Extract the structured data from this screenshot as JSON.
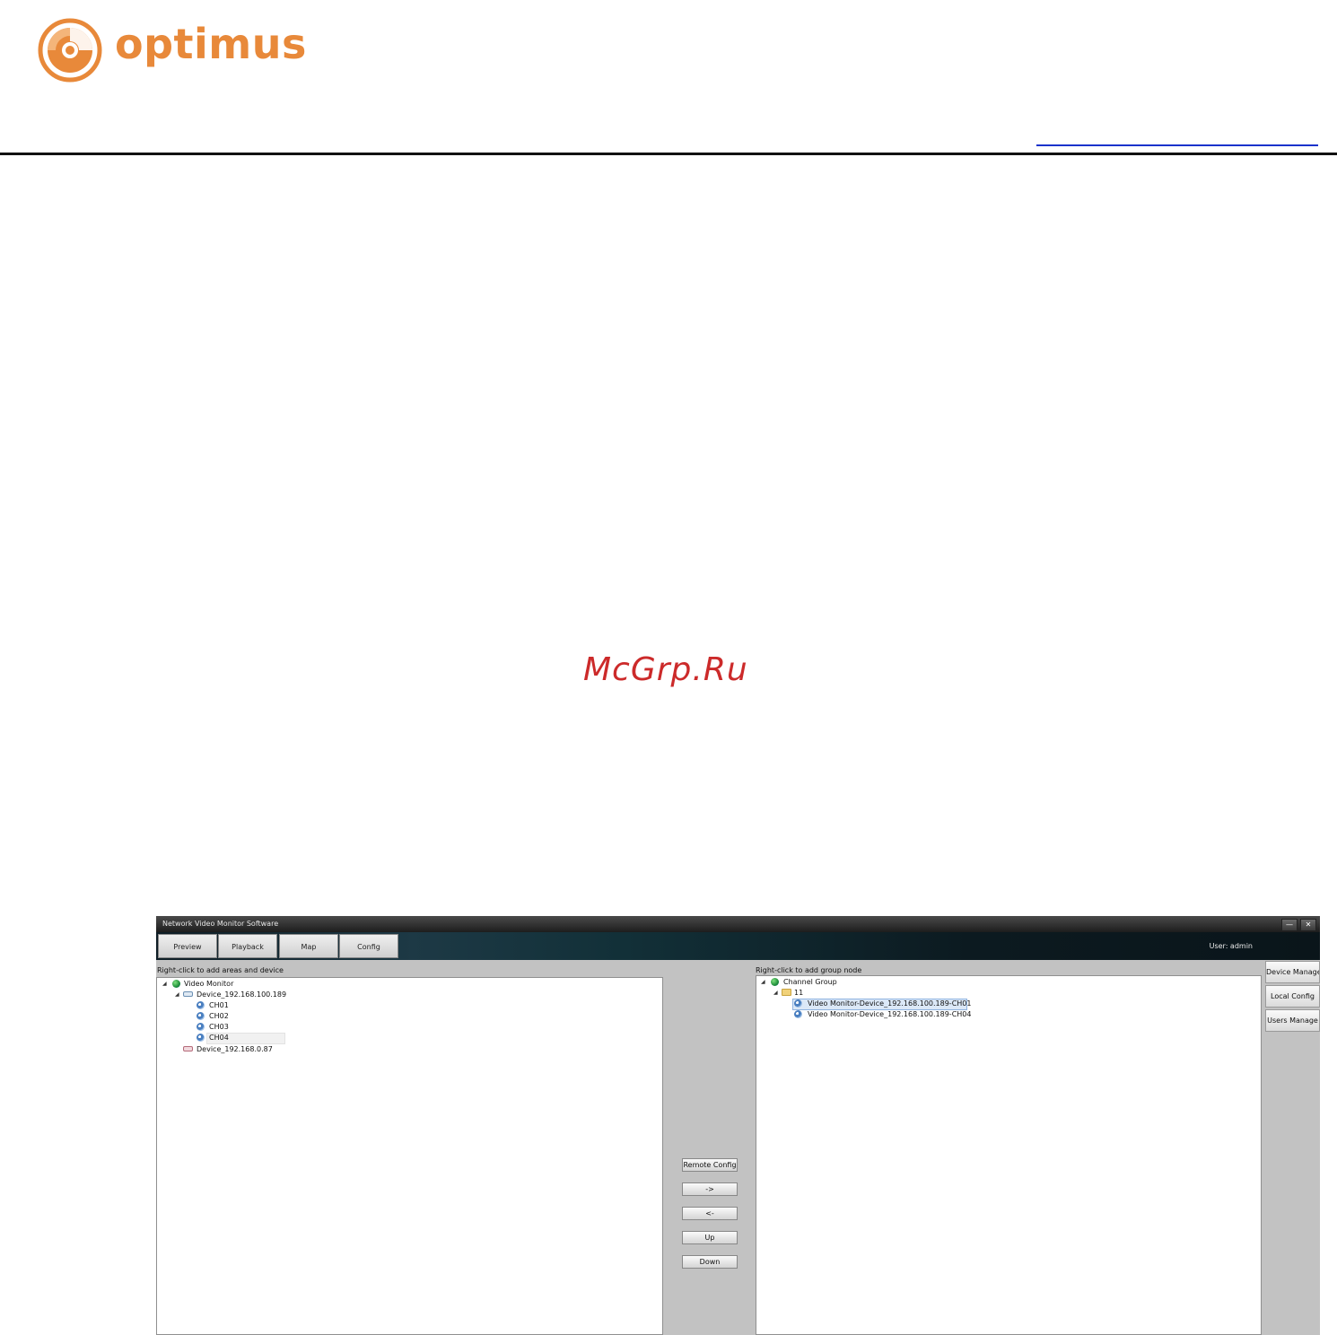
{
  "brand": {
    "name": "optimus",
    "accent": "#e8893a"
  },
  "watermark": "McGrp.Ru",
  "app": {
    "title": "Network Video Monitor Software",
    "window_buttons": {
      "minimize": "—",
      "close": "✕"
    },
    "tabs": [
      "Preview",
      "Playback",
      "Map",
      "Config"
    ],
    "user": "User: admin",
    "left_panel": {
      "hint": "Right-click to add areas and device",
      "root": "Video Monitor",
      "device1": "Device_192.168.100.189",
      "channels": [
        "CH01",
        "CH02",
        "CH03",
        "CH04"
      ],
      "device2": "Device_192.168.0.87"
    },
    "right_panel": {
      "hint": "Right-click to add group node",
      "root": "Channel Group",
      "group": "11",
      "items": [
        "Video Monitor-Device_192.168.100.189-CH01",
        "Video Monitor-Device_192.168.100.189-CH04"
      ]
    },
    "middle_buttons": {
      "remote_config": "Remote Config",
      "add": "->",
      "remove": "<-",
      "up": "Up",
      "down": "Down"
    },
    "side_buttons": [
      "Device Manage",
      "Local Config",
      "Users Manage"
    ]
  }
}
